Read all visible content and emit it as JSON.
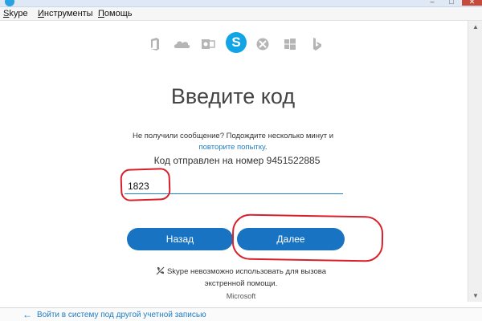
{
  "window": {
    "title": "Skype"
  },
  "menu": {
    "items": [
      "Skype",
      "Инструменты",
      "Помощь"
    ]
  },
  "service_icons": [
    "office-icon",
    "onedrive-icon",
    "outlook-icon",
    "skype-icon",
    "xbox-icon",
    "windows-icon",
    "bing-icon"
  ],
  "page": {
    "heading": "Введите код",
    "note_line1": "Не получили сообщение? Подождите несколько минут и",
    "retry_link": "повторите попытку",
    "code_sent": "Код отправлен на номер 9451522885",
    "code_value": "1823",
    "back_button": "Назад",
    "next_button": "Далее",
    "disclaimer_line1": "Skype невозможно использовать для вызова",
    "disclaimer_line2": "экстренной помощи.",
    "footer_brand": "Microsoft"
  },
  "bottom": {
    "other_account_link": "Войти в систему под другой учетной записью"
  },
  "colors": {
    "accent": "#1873c2",
    "link": "#1e7fc6",
    "highlight": "#d9202a",
    "skype": "#12a5e6"
  }
}
